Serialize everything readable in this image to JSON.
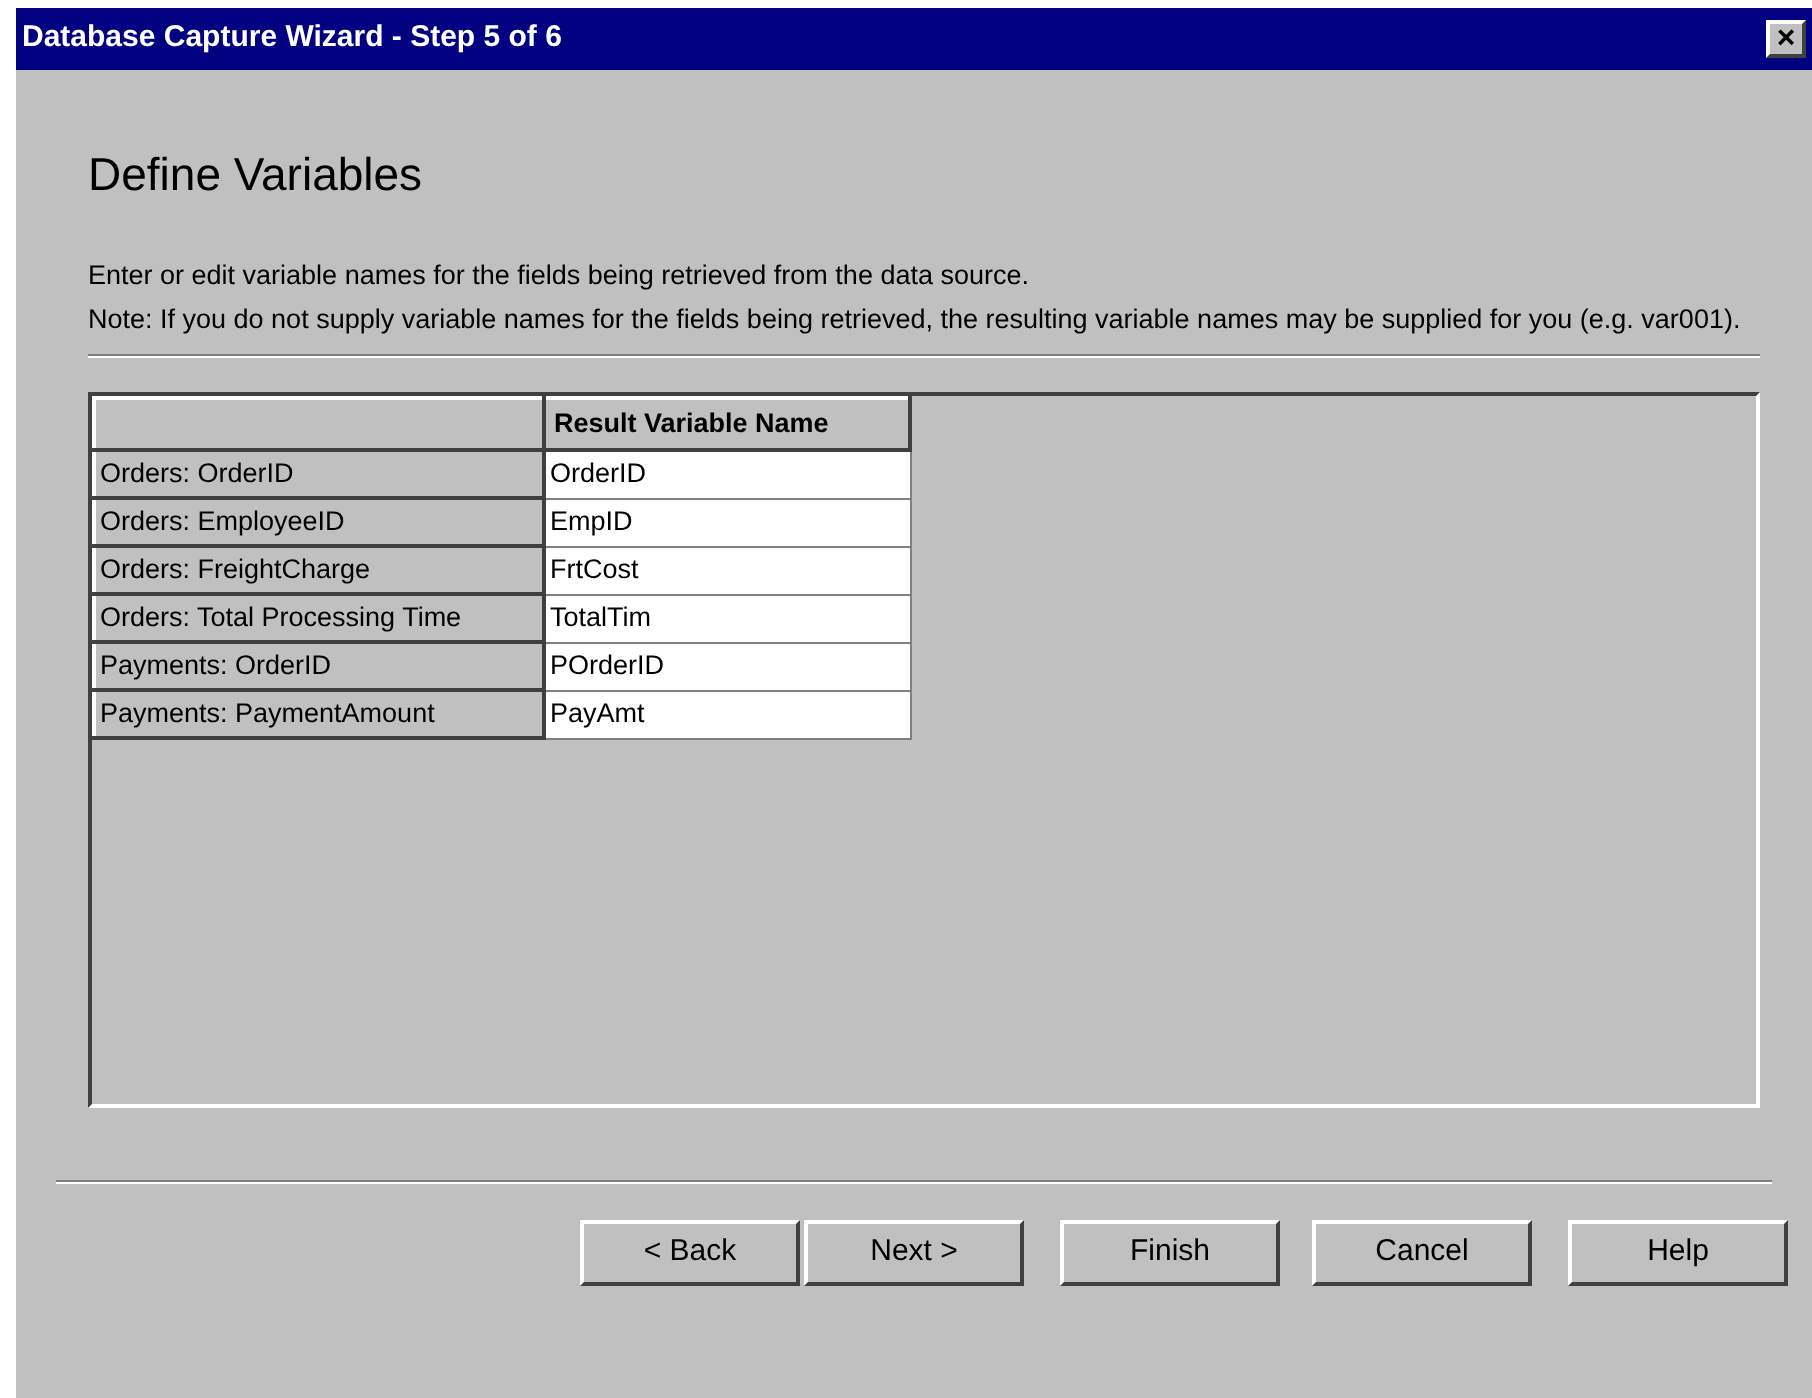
{
  "window": {
    "title": "Database Capture Wizard - Step 5 of 6",
    "close": "×"
  },
  "heading": "Define Variables",
  "instructions": [
    "Enter or edit variable names for the fields being retrieved from the data source.",
    "Note: If you do not supply variable names for the fields being retrieved, the resulting variable names may be supplied for you (e.g. var001)."
  ],
  "table": {
    "columns": [
      "Result Variable Name"
    ],
    "rows": [
      {
        "field": "Orders: OrderID",
        "variable": "OrderID"
      },
      {
        "field": "Orders: EmployeeID",
        "variable": "EmpID"
      },
      {
        "field": "Orders: FreightCharge",
        "variable": "FrtCost"
      },
      {
        "field": "Orders: Total Processing Time",
        "variable": "TotalTim"
      },
      {
        "field": "Payments: OrderID",
        "variable": "POrderID"
      },
      {
        "field": "Payments: PaymentAmount",
        "variable": "PayAmt"
      }
    ]
  },
  "buttons": [
    "< Back",
    "Next >",
    "Finish",
    "Cancel",
    "Help"
  ]
}
